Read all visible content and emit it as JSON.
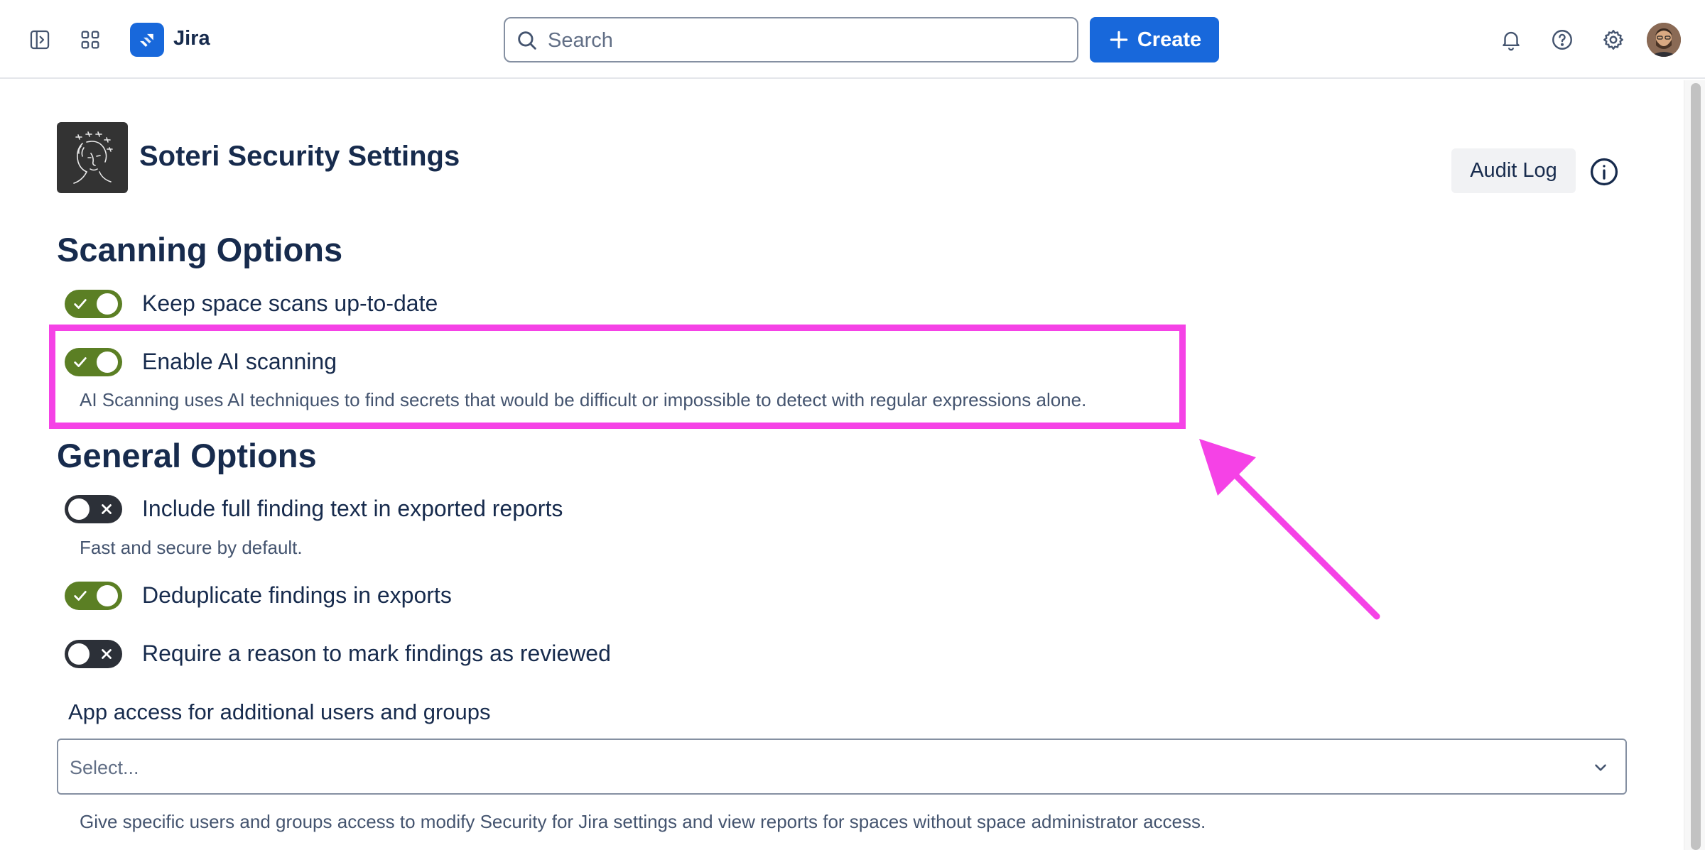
{
  "topbar": {
    "app_name": "Jira",
    "search_placeholder": "Search",
    "create_label": "Create"
  },
  "page": {
    "title": "Soteri Security Settings",
    "audit_log_label": "Audit Log"
  },
  "scanning": {
    "heading": "Scanning Options",
    "options": [
      {
        "label": "Keep space scans up-to-date",
        "enabled": true
      },
      {
        "label": "Enable AI scanning",
        "enabled": true,
        "description": "AI Scanning uses AI techniques to find secrets that would be difficult or impossible to detect with regular expressions alone."
      }
    ]
  },
  "general": {
    "heading": "General Options",
    "options": [
      {
        "label": "Include full finding text in exported reports",
        "enabled": false,
        "description": "Fast and secure by default."
      },
      {
        "label": "Deduplicate findings in exports",
        "enabled": true
      },
      {
        "label": "Require a reason to mark findings as reviewed",
        "enabled": false
      }
    ]
  },
  "access": {
    "label": "App access for additional users and groups",
    "select_placeholder": "Select...",
    "help": "Give specific users and groups access to modify Security for Jira settings and view reports for spaces without space administrator access."
  },
  "colors": {
    "brand": "#1868db",
    "toggle_on": "#5b7f24",
    "toggle_off": "#2c3038",
    "annotation": "#f542e6"
  },
  "icons": [
    "sidebar-toggle-icon",
    "app-switcher-icon",
    "jira-logo-icon",
    "search-icon",
    "plus-icon",
    "bell-icon",
    "help-icon",
    "gear-icon",
    "info-icon",
    "check-icon",
    "x-icon",
    "chevron-down-icon"
  ]
}
